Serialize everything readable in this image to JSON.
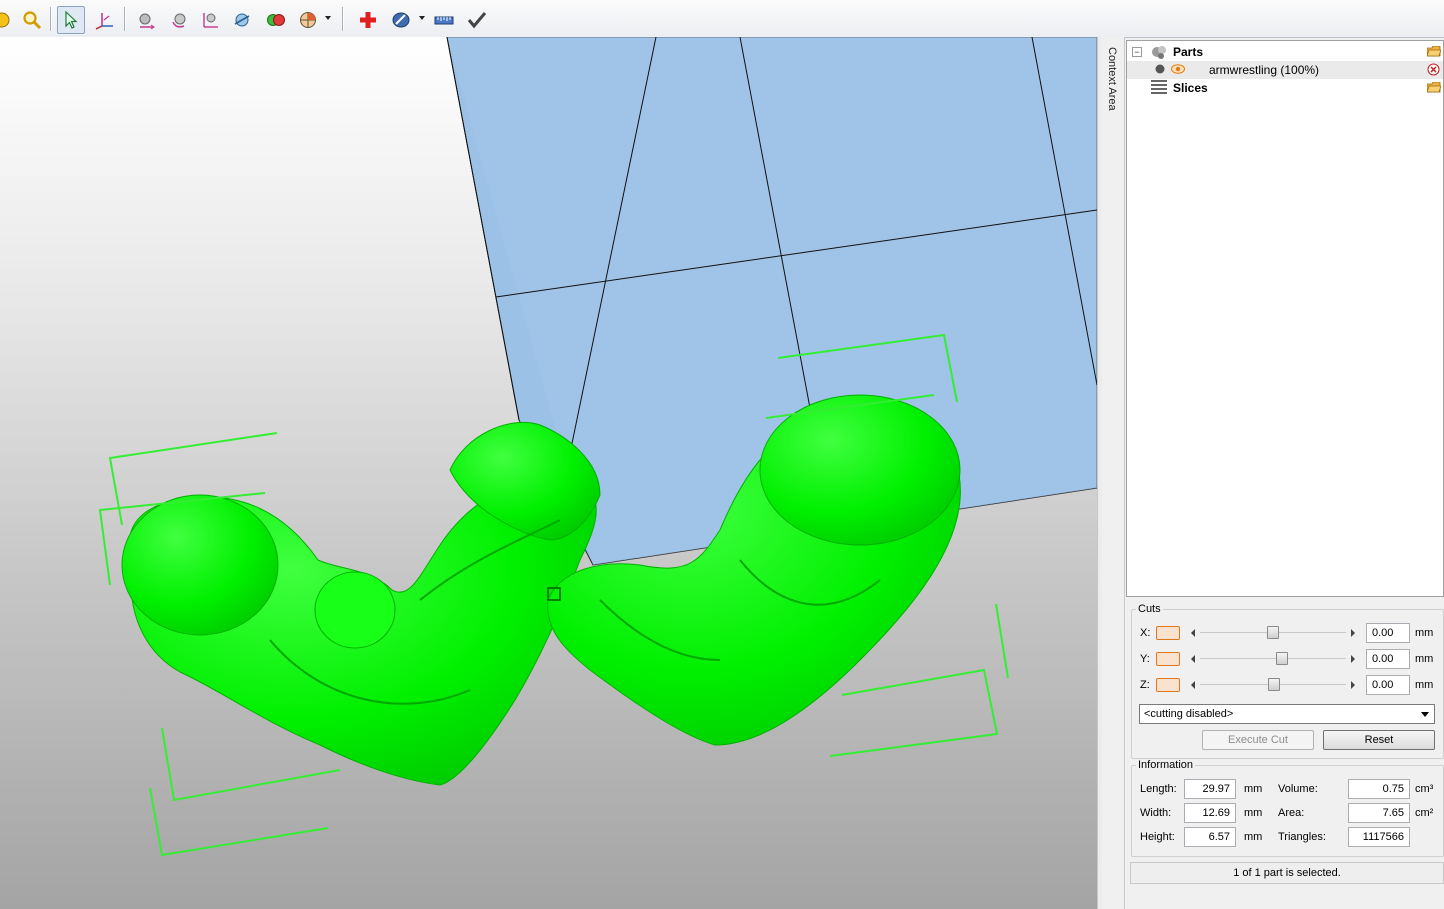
{
  "toolbar": {
    "tools": [
      {
        "name": "open-icon"
      },
      {
        "name": "zoom-icon"
      },
      {
        "name": "select-arrow-icon"
      },
      {
        "name": "coordinate-axes-icon"
      },
      {
        "name": "move-part-icon"
      },
      {
        "name": "rotate-part-icon"
      },
      {
        "name": "scale-part-icon"
      },
      {
        "name": "mirror-part-icon"
      },
      {
        "name": "merge-parts-icon"
      },
      {
        "name": "view-options-icon"
      },
      {
        "name": "add-part-icon"
      },
      {
        "name": "render-mode-icon"
      },
      {
        "name": "measure-ruler-icon"
      },
      {
        "name": "checkmark-icon"
      }
    ]
  },
  "viewport": {
    "model_color": "#00ff00",
    "bed_color": "#9cc1e6",
    "bounding_box_color": "#33ee33"
  },
  "context_tab": {
    "label": "Context Area"
  },
  "tree": {
    "parts_label": "Parts",
    "part_item": "armwrestling (100%)",
    "slices_label": "Slices"
  },
  "cuts": {
    "title": "Cuts",
    "axes": [
      {
        "label": "X:",
        "value": "0.00",
        "unit": "mm",
        "slider_fraction": 0.5
      },
      {
        "label": "Y:",
        "value": "0.00",
        "unit": "mm",
        "slider_fraction": 0.57
      },
      {
        "label": "Z:",
        "value": "0.00",
        "unit": "mm",
        "slider_fraction": 0.51
      }
    ],
    "mode_select": "<cutting disabled>",
    "execute_label": "Execute Cut",
    "reset_label": "Reset"
  },
  "information": {
    "title": "Information",
    "length_label": "Length:",
    "length_value": "29.97",
    "length_unit": "mm",
    "width_label": "Width:",
    "width_value": "12.69",
    "width_unit": "mm",
    "height_label": "Height:",
    "height_value": "6.57",
    "height_unit": "mm",
    "volume_label": "Volume:",
    "volume_value": "0.75",
    "volume_unit": "cm³",
    "area_label": "Area:",
    "area_value": "7.65",
    "area_unit": "cm²",
    "triangles_label": "Triangles:",
    "triangles_value": "1117566"
  },
  "status": {
    "selection_text": "1 of 1 part is selected."
  }
}
